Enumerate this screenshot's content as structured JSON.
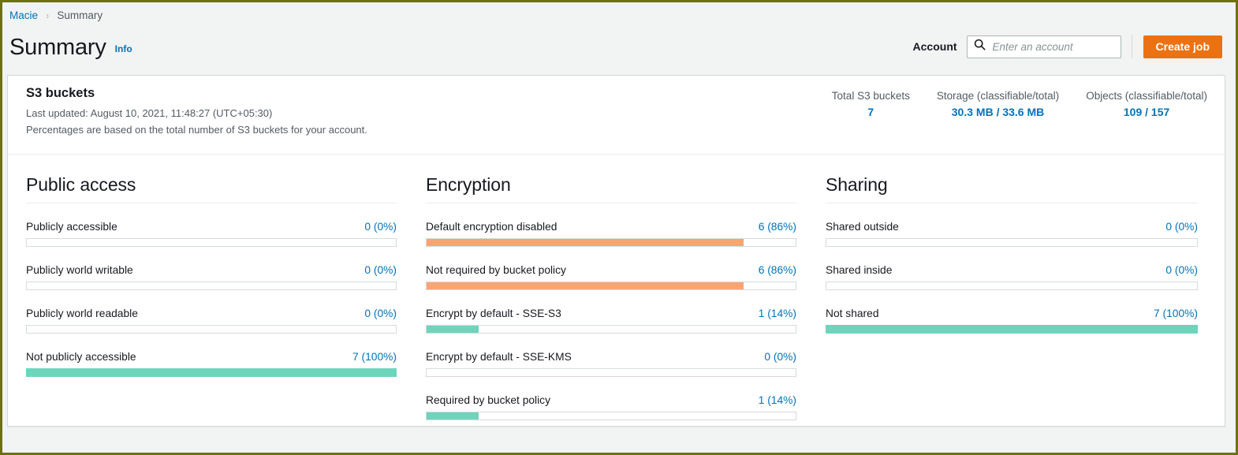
{
  "breadcrumb": {
    "root": "Macie",
    "separator": "›",
    "current": "Summary"
  },
  "header": {
    "title": "Summary",
    "info_link": "Info",
    "account_label": "Account",
    "account_placeholder": "Enter an account",
    "account_value": "",
    "search_icon": "search-icon",
    "create_job_label": "Create job",
    "accent_color": "#ec7211",
    "link_color": "#0073bb"
  },
  "panel": {
    "title": "S3 buckets",
    "last_updated": "Last updated: August 10, 2021, 11:48:27 (UTC+05:30)",
    "note": "Percentages are based on the total number of S3 buckets for your account.",
    "stats": [
      {
        "label": "Total S3 buckets",
        "value": "7"
      },
      {
        "label": "Storage (classifiable/total)",
        "value": "30.3 MB / 33.6 MB"
      },
      {
        "label": "Objects (classifiable/total)",
        "value": "109 / 157"
      }
    ]
  },
  "chart_data": {
    "type": "bar",
    "title": "S3 buckets",
    "orientation": "horizontal",
    "total_buckets": 7,
    "colors": {
      "positive": "#6fd4bc",
      "negative": "#faa476",
      "empty_track": "#ffffff",
      "track_border": "#d5dbdb"
    },
    "sections": [
      {
        "title": "Public access",
        "categories": [
          "Publicly accessible",
          "Publicly world writable",
          "Publicly world readable",
          "Not publicly accessible"
        ],
        "values": [
          0,
          0,
          0,
          7
        ],
        "percents": [
          0,
          0,
          0,
          100
        ],
        "value_labels": [
          "0 (0%)",
          "0 (0%)",
          "0 (0%)",
          "7 (100%)"
        ],
        "bar_colors": [
          "#faa476",
          "#faa476",
          "#faa476",
          "#6fd4bc"
        ]
      },
      {
        "title": "Encryption",
        "categories": [
          "Default encryption disabled",
          "Not required by bucket policy",
          "Encrypt by default - SSE-S3",
          "Encrypt by default - SSE-KMS",
          "Required by bucket policy"
        ],
        "values": [
          6,
          6,
          1,
          0,
          1
        ],
        "percents": [
          86,
          86,
          14,
          0,
          14
        ],
        "value_labels": [
          "6 (86%)",
          "6 (86%)",
          "1 (14%)",
          "0 (0%)",
          "1 (14%)"
        ],
        "bar_colors": [
          "#faa476",
          "#faa476",
          "#6fd4bc",
          "#6fd4bc",
          "#6fd4bc"
        ]
      },
      {
        "title": "Sharing",
        "categories": [
          "Shared outside",
          "Shared inside",
          "Not shared"
        ],
        "values": [
          0,
          0,
          7
        ],
        "percents": [
          0,
          0,
          100
        ],
        "value_labels": [
          "0 (0%)",
          "0 (0%)",
          "7 (100%)"
        ],
        "bar_colors": [
          "#faa476",
          "#faa476",
          "#6fd4bc"
        ]
      }
    ]
  }
}
